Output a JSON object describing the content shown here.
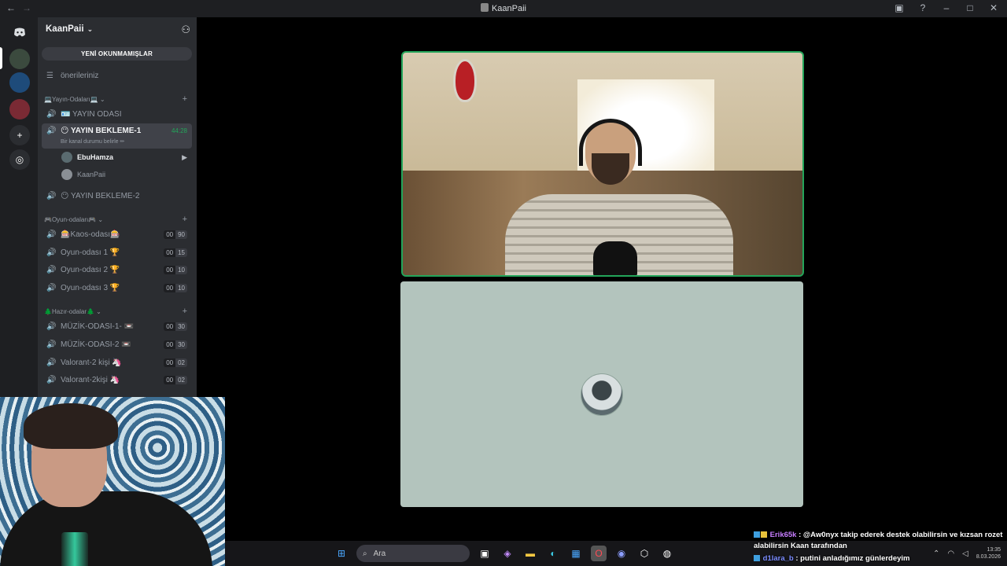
{
  "window": {
    "title": "KaanPaii"
  },
  "server": {
    "name": "KaanPaii",
    "unread_banner": "YENİ OKUNMAMIŞLAR",
    "suggestions": "önerileriniz"
  },
  "categories": [
    {
      "label": "💻Yayın-Odaları💻"
    },
    {
      "label": "🎮Oyun-odaları🎮"
    },
    {
      "label": "🌲Hazır-odalar🌲"
    }
  ],
  "channels": {
    "yayin_odasi": "🪪 YAYIN ODASI",
    "bekleme1": "😶 YAYIN BEKLEME-1",
    "bekleme1_timer": "44:28",
    "bekleme1_status": "Bir kanal durumu belirle ✏",
    "bekleme2": "😶 YAYIN BEKLEME-2",
    "games": [
      {
        "label": "🎰Kaos-odası🎰",
        "a": "00",
        "b": "90"
      },
      {
        "label": "Oyun-odası 1 🏆",
        "a": "00",
        "b": "15"
      },
      {
        "label": "Oyun-odası 2 🏆",
        "a": "00",
        "b": "10"
      },
      {
        "label": "Oyun-odası 3 🏆",
        "a": "00",
        "b": "10"
      }
    ],
    "ready": [
      {
        "label": "MÜZİK-ODASI-1- 📼",
        "a": "00",
        "b": "30"
      },
      {
        "label": "MÜZİK-ODASI-2 📼",
        "a": "00",
        "b": "30"
      },
      {
        "label": "Valorant-2 kişi 🦄",
        "a": "00",
        "b": "02"
      },
      {
        "label": "Valorant-2kişi 🦄",
        "a": "00",
        "b": "02"
      }
    ]
  },
  "members": [
    {
      "name": "EbuHamza"
    },
    {
      "name": "KaanPaii"
    }
  ],
  "taskbar": {
    "search_placeholder": "Ara",
    "time": "13:35",
    "date": "8.03.2026"
  },
  "chat": {
    "line1_user": "Erik65k",
    "line1_text": ": @Aw0nyx takip ederek destek olabilirsin ve kızsan rozet alabilirsin Kaan tarafından",
    "line2_user": "d1lara_b",
    "line2_text": ": putini anladığımız günlerdeyim"
  },
  "colors": {
    "accent_green": "#23a55a",
    "sidebar_bg": "#2b2d31",
    "rail_bg": "#1e1f22"
  }
}
